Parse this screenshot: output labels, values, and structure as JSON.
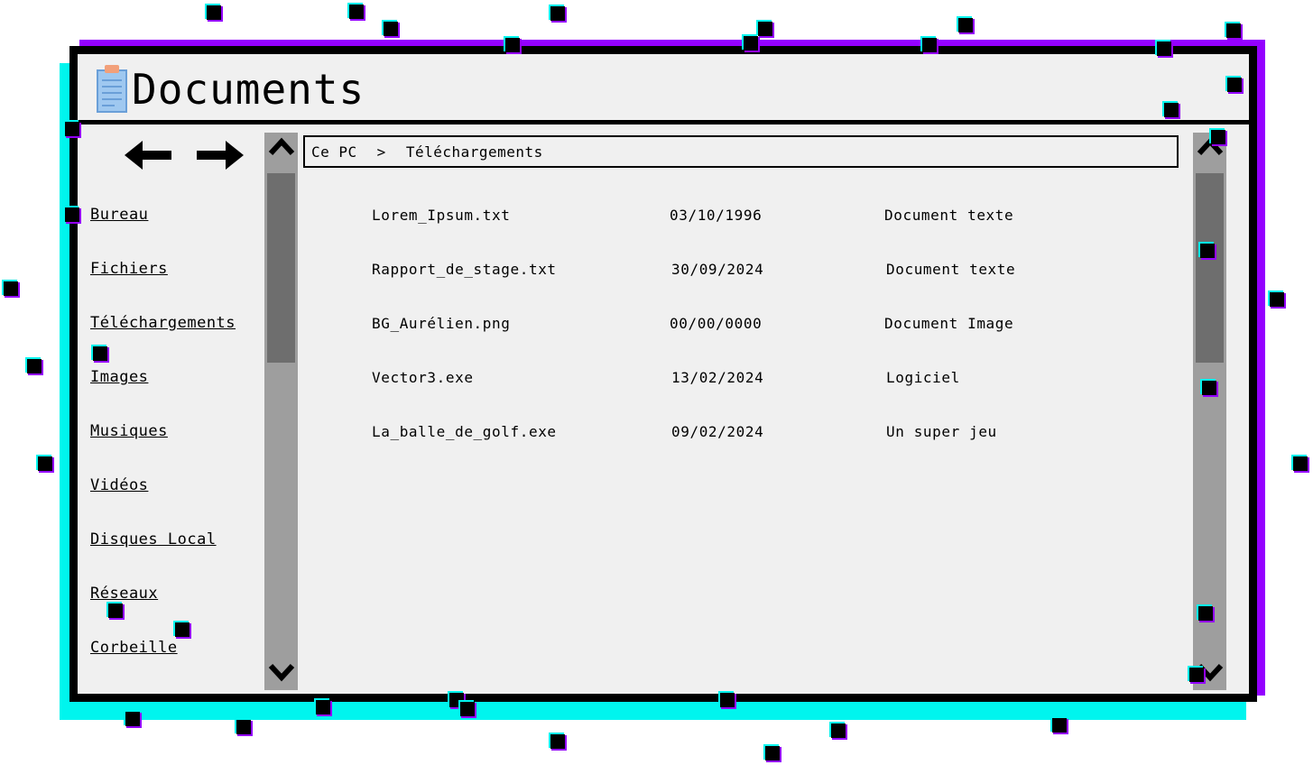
{
  "window": {
    "title": "Documents"
  },
  "nav": {
    "back_icon": "arrow-left-icon",
    "forward_icon": "arrow-right-icon"
  },
  "sidebar": {
    "items": [
      {
        "label": "Bureau"
      },
      {
        "label": "Fichiers"
      },
      {
        "label": "Téléchargements"
      },
      {
        "label": "Images"
      },
      {
        "label": "Musiques"
      },
      {
        "label": "Vidéos"
      },
      {
        "label": "Disques Local"
      },
      {
        "label": "Réseaux"
      },
      {
        "label": "Corbeille"
      }
    ]
  },
  "breadcrumb": {
    "root": "Ce PC",
    "separator": ">",
    "current": "Téléchargements"
  },
  "files": [
    {
      "name": "Lorem_Ipsum.txt",
      "date": "03/10/1996",
      "type": "Document texte"
    },
    {
      "name": "Rapport_de_stage.txt",
      "date": "30/09/2024",
      "type": "Document texte"
    },
    {
      "name": "BG_Aurélien.png",
      "date": "00/00/0000",
      "type": "Document Image"
    },
    {
      "name": "Vector3.exe",
      "date": "13/02/2024",
      "type": "Logiciel"
    },
    {
      "name": "La_balle_de_golf.exe",
      "date": "09/02/2024",
      "type": "Un super jeu"
    }
  ],
  "colors": {
    "glitch_cyan": "#00f5ee",
    "glitch_purple": "#9400ff",
    "window_bg": "#f0f0f0",
    "scrollbar_track": "#9e9e9e",
    "scrollbar_thumb": "#6e6e6e"
  }
}
